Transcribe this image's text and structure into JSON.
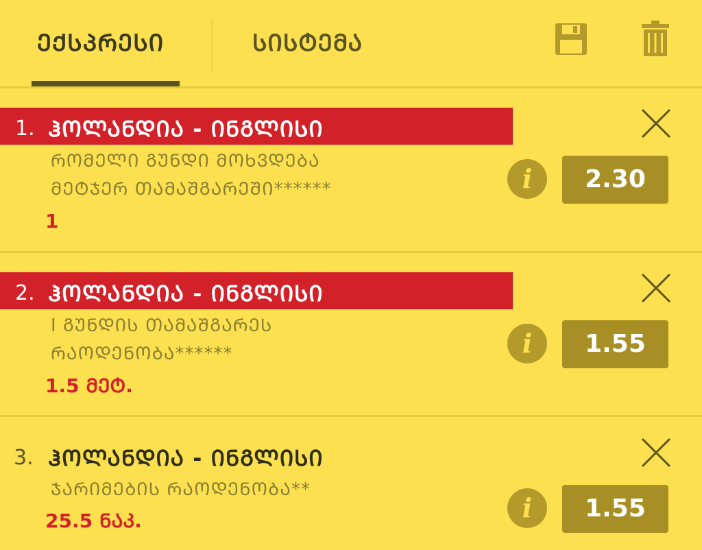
{
  "tabs": [
    {
      "label": "ᲔᲥᲡᲞᲠᲔᲡᲘ",
      "active": true
    },
    {
      "label": "ᲡᲘᲡᲢᲔᲛᲐ",
      "active": false
    }
  ],
  "toolbar": {
    "save_icon": "save-icon",
    "trash_icon": "trash-icon"
  },
  "colors": {
    "background": "#fde04f",
    "highlight_red": "#d22129",
    "odds_button": "#a88f25",
    "info_icon": "#b49a2a"
  },
  "bets": [
    {
      "number": "1.",
      "title": "ᲰᲝᲚᲐᲜᲓᲘᲐ - ᲘᲜᲒᲚᲘᲡᲘ",
      "market_line1": "ᲠᲝᲛᲔᲚᲘ ᲒᲣᲜᲓᲘ ᲛᲝᲮᲕᲓᲔᲑᲐ",
      "market_line2": "ᲛᲔᲢᲯᲔᲠ ᲗᲐᲛᲐᲨᲒᲐᲠᲔᲨᲘ******",
      "pick": "1",
      "odds": "2.30",
      "highlighted": true
    },
    {
      "number": "2.",
      "title": "ᲰᲝᲚᲐᲜᲓᲘᲐ - ᲘᲜᲒᲚᲘᲡᲘ",
      "market_line1": "I ᲒᲣᲜᲓᲘᲡ ᲗᲐᲛᲐᲨᲒᲐᲠᲔᲡ",
      "market_line2": "ᲠᲐᲝᲓᲔᲜᲝᲑᲐ******",
      "pick": "1.5 ᲛᲔᲢ.",
      "odds": "1.55",
      "highlighted": true
    },
    {
      "number": "3.",
      "title": "ᲰᲝᲚᲐᲜᲓᲘᲐ - ᲘᲜᲒᲚᲘᲡᲘ",
      "market_line1": "ᲯᲐᲠᲘᲛᲔᲑᲘᲡ ᲠᲐᲝᲓᲔᲜᲝᲑᲐ**",
      "market_line2": "",
      "pick": "25.5 ᲜᲐᲙ.",
      "odds": "1.55",
      "highlighted": false
    }
  ]
}
